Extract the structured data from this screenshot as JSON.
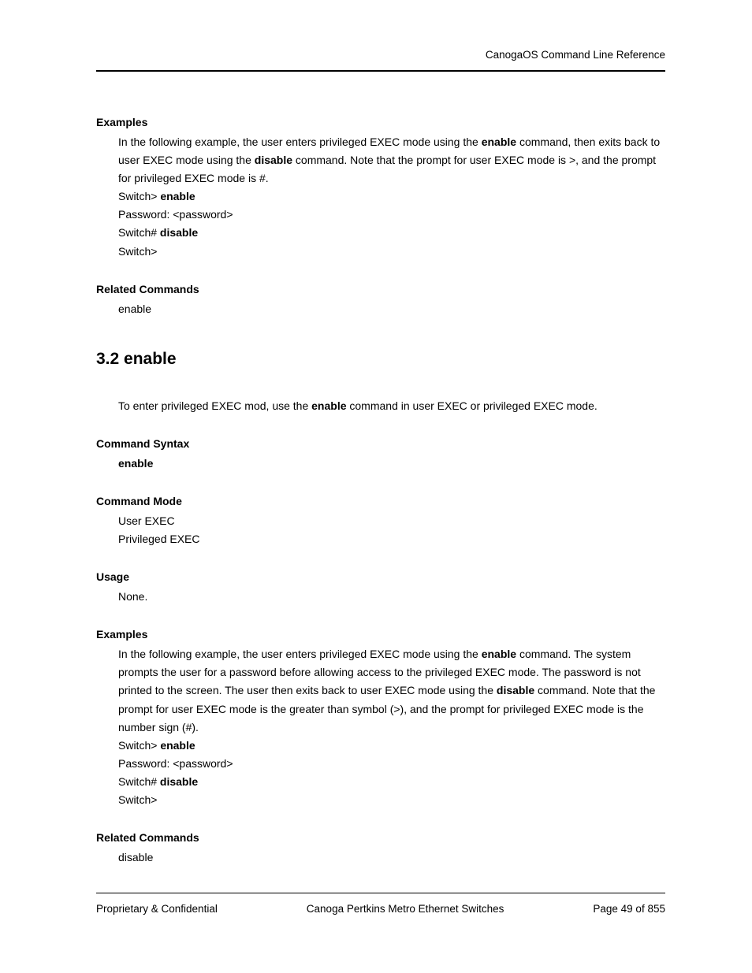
{
  "header": {
    "running": "CanogaOS Command Line Reference"
  },
  "sections": {
    "examples1": {
      "label": "Examples",
      "para_parts": [
        "In the following example, the user enters privileged EXEC mode using the ",
        "enable",
        " command, then exits back to user EXEC mode using the ",
        "disable",
        " command. Note that the prompt for user EXEC mode is >, and the prompt for privileged EXEC mode is #."
      ],
      "lines": {
        "l1p": "Switch> ",
        "l1c": "enable",
        "l2": "Password: <password>",
        "l3p": "Switch# ",
        "l3c": "disable",
        "l4": "Switch>"
      }
    },
    "related1": {
      "label": "Related Commands",
      "text": "enable"
    },
    "heading": "3.2  enable",
    "intro_parts": [
      "To enter privileged EXEC mod, use the ",
      "enable",
      " command in user EXEC or privileged EXEC mode."
    ],
    "syntax": {
      "label": "Command Syntax",
      "text": "enable"
    },
    "mode": {
      "label": "Command Mode",
      "l1": "User EXEC",
      "l2": "Privileged EXEC"
    },
    "usage": {
      "label": "Usage",
      "text": "None."
    },
    "examples2": {
      "label": "Examples",
      "para_parts": [
        "In the following example, the user enters privileged EXEC mode using the ",
        "enable",
        " command. The system prompts the user for a password before allowing access to the privileged EXEC mode. The password is not printed to the screen. The user then exits back to user EXEC mode using the ",
        "disable",
        " command. Note that the prompt for user EXEC mode is the greater than symbol (>), and the prompt for privileged EXEC mode is the number sign (#)."
      ],
      "lines": {
        "l1p": "Switch> ",
        "l1c": "enable",
        "l2": "Password: <password>",
        "l3p": "Switch# ",
        "l3c": "disable",
        "l4": "Switch>"
      }
    },
    "related2": {
      "label": "Related Commands",
      "text": "disable"
    }
  },
  "footer": {
    "left": "Proprietary & Confidential",
    "center": "Canoga Pertkins Metro Ethernet Switches",
    "right": "Page 49 of 855"
  }
}
